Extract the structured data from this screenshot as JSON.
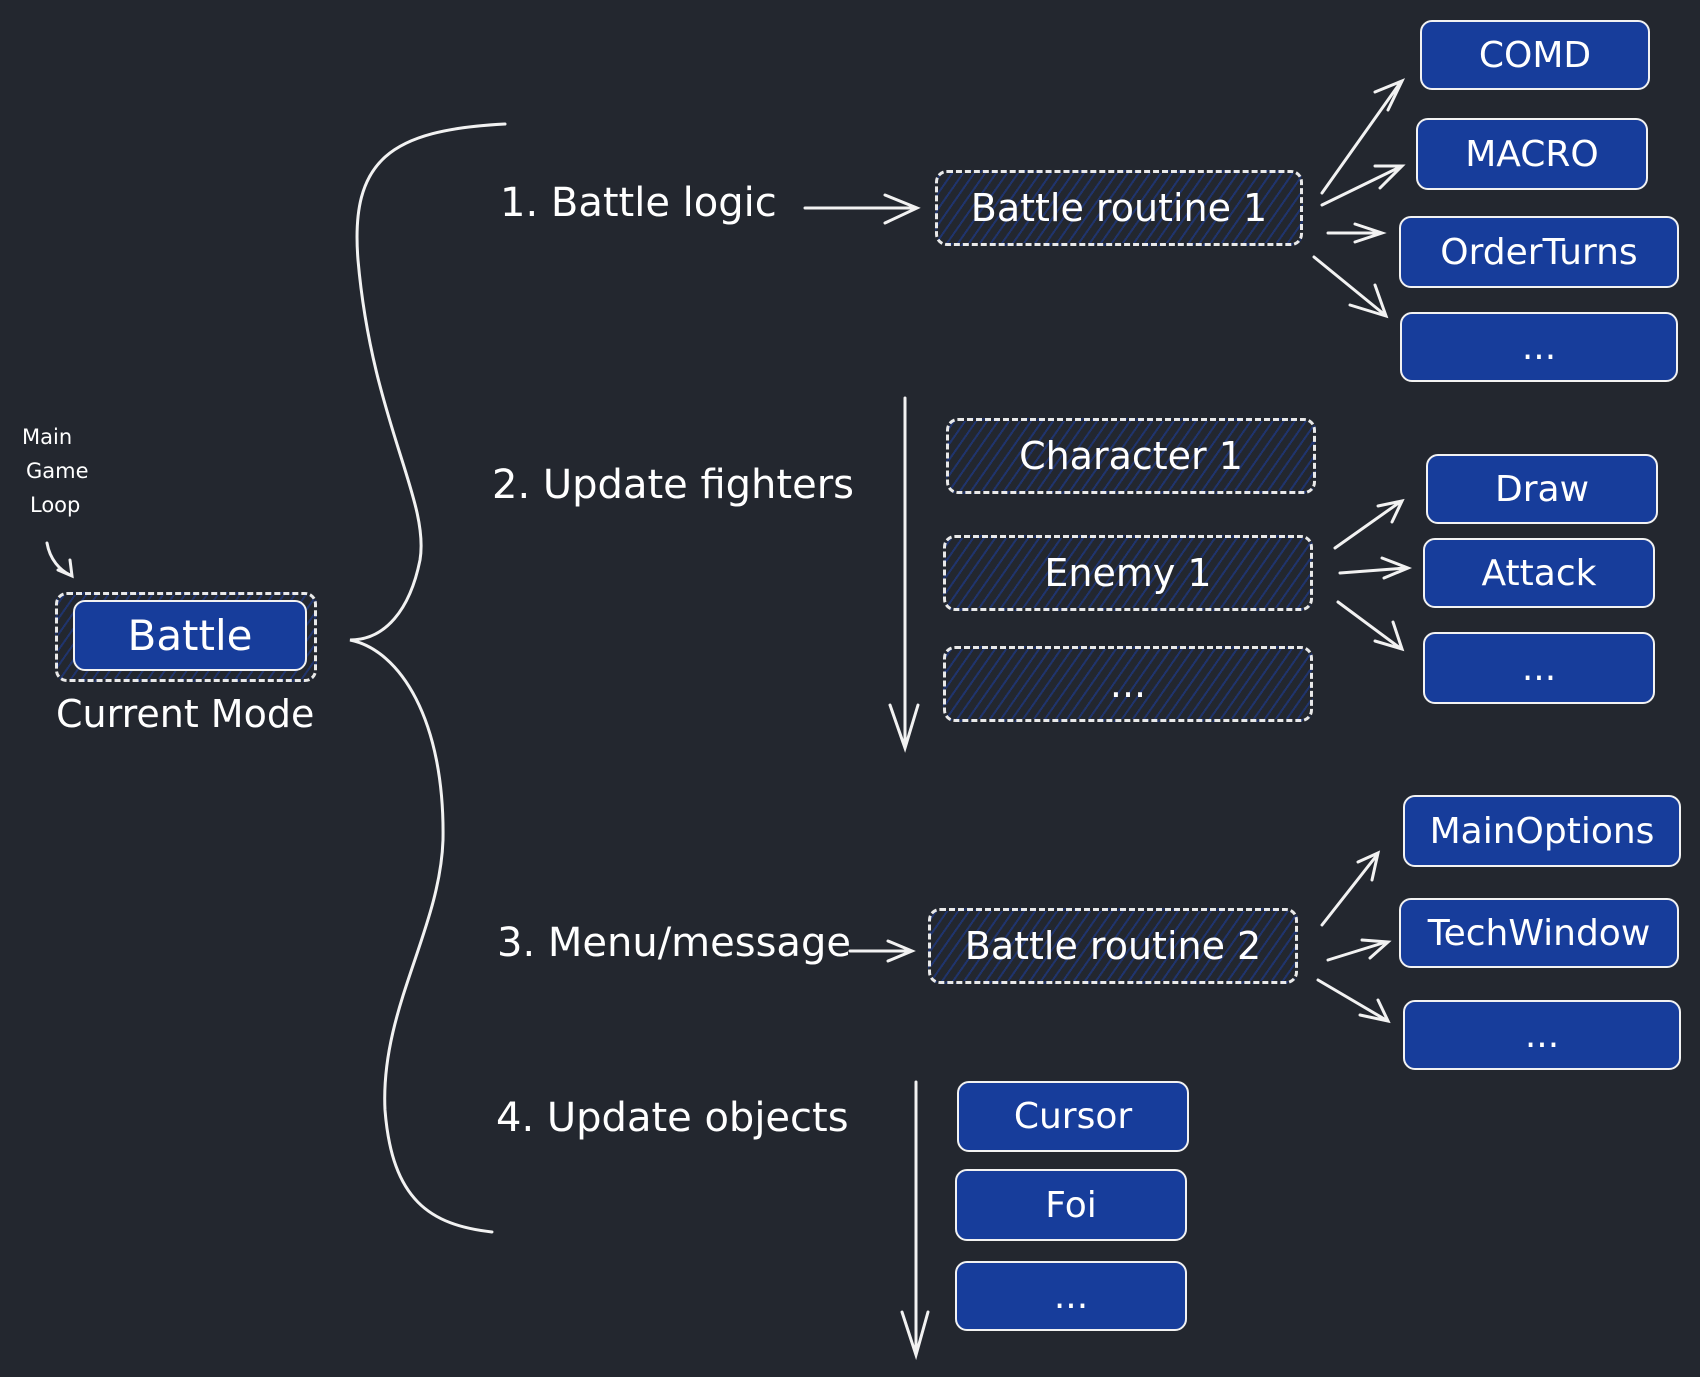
{
  "annotation": {
    "lines": [
      "Main",
      "Game",
      "Loop"
    ]
  },
  "current_mode": {
    "box_label": "Battle",
    "caption": "Current Mode"
  },
  "steps": [
    {
      "label": "1. Battle logic"
    },
    {
      "label": "2. Update fighters"
    },
    {
      "label": "3. Menu/message"
    },
    {
      "label": "4. Update objects"
    }
  ],
  "battle_routine_1": {
    "label": "Battle routine 1",
    "children": [
      "COMD",
      "MACRO",
      "OrderTurns",
      "..."
    ]
  },
  "fighters": {
    "items": [
      "Character 1",
      "Enemy 1",
      "..."
    ],
    "enemy_children": [
      "Draw",
      "Attack",
      "..."
    ]
  },
  "battle_routine_2": {
    "label": "Battle routine 2",
    "children": [
      "MainOptions",
      "TechWindow",
      "..."
    ]
  },
  "objects": {
    "items": [
      "Cursor",
      "Foi",
      "..."
    ]
  },
  "colors": {
    "background": "#23272f",
    "box_fill": "#173d9b",
    "stroke": "#ffffff"
  }
}
